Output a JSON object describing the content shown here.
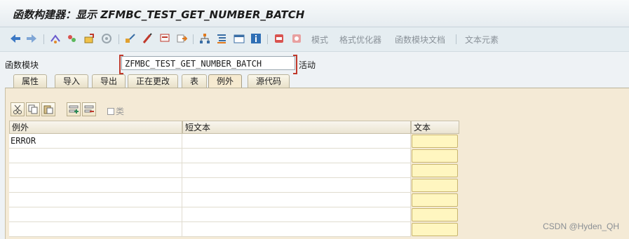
{
  "window": {
    "title": "函数构建器：显示 ZFMBC_TEST_GET_NUMBER_BATCH"
  },
  "toolbar": {
    "icons": [
      "back-icon",
      "forward-icon",
      "other-object-icon",
      "display-change-icon",
      "activate-icon",
      "check-icon",
      "where-used-icon",
      "display-object-list-icon",
      "navigation-window-icon",
      "hierarchy-icon",
      "outline-icon",
      "frame-icon",
      "info-icon",
      "test-icon",
      "debug-icon"
    ],
    "mode_label": "模式",
    "pretty_printer_label": "格式优化器",
    "fm_doc_label": "函数模块文档",
    "text_elements_label": "文本元素"
  },
  "function_module": {
    "label": "函数模块",
    "value": "ZFMBC_TEST_GET_NUMBER_BATCH",
    "status": "活动"
  },
  "tabs": [
    {
      "label": "属性"
    },
    {
      "label": "导入"
    },
    {
      "label": "导出"
    },
    {
      "label": "正在更改"
    },
    {
      "label": "表"
    },
    {
      "label": "例外",
      "active": true
    },
    {
      "label": "源代码"
    }
  ],
  "table_tools": {
    "icons": [
      "cut-icon",
      "copy-icon",
      "paste-icon",
      "insert-row-icon",
      "delete-row-icon"
    ],
    "class_checkbox_label": "类"
  },
  "table": {
    "columns": [
      "例外",
      "短文本",
      "文本"
    ],
    "rows": [
      {
        "exception": "ERROR",
        "short_text": ""
      },
      {
        "exception": "",
        "short_text": ""
      },
      {
        "exception": "",
        "short_text": ""
      },
      {
        "exception": "",
        "short_text": ""
      },
      {
        "exception": "",
        "short_text": ""
      },
      {
        "exception": "",
        "short_text": ""
      },
      {
        "exception": "",
        "short_text": ""
      }
    ]
  },
  "watermark": "CSDN @Hyden_QH"
}
